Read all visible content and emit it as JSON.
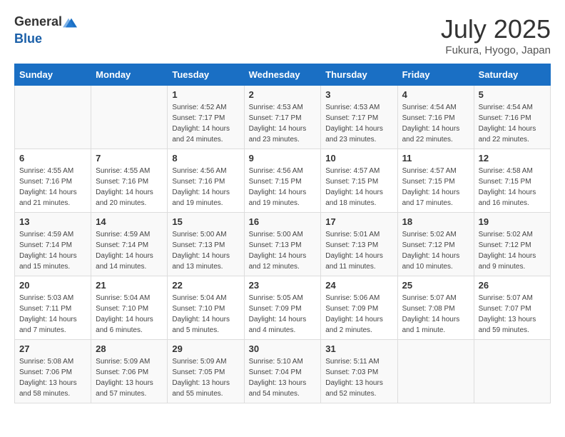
{
  "header": {
    "logo_general": "General",
    "logo_blue": "Blue",
    "month_year": "July 2025",
    "location": "Fukura, Hyogo, Japan"
  },
  "days_of_week": [
    "Sunday",
    "Monday",
    "Tuesday",
    "Wednesday",
    "Thursday",
    "Friday",
    "Saturday"
  ],
  "weeks": [
    [
      {
        "day": "",
        "empty": true
      },
      {
        "day": "",
        "empty": true
      },
      {
        "day": "1",
        "sunrise": "4:52 AM",
        "sunset": "7:17 PM",
        "daylight": "14 hours and 24 minutes."
      },
      {
        "day": "2",
        "sunrise": "4:53 AM",
        "sunset": "7:17 PM",
        "daylight": "14 hours and 23 minutes."
      },
      {
        "day": "3",
        "sunrise": "4:53 AM",
        "sunset": "7:17 PM",
        "daylight": "14 hours and 23 minutes."
      },
      {
        "day": "4",
        "sunrise": "4:54 AM",
        "sunset": "7:16 PM",
        "daylight": "14 hours and 22 minutes."
      },
      {
        "day": "5",
        "sunrise": "4:54 AM",
        "sunset": "7:16 PM",
        "daylight": "14 hours and 22 minutes."
      }
    ],
    [
      {
        "day": "6",
        "sunrise": "4:55 AM",
        "sunset": "7:16 PM",
        "daylight": "14 hours and 21 minutes."
      },
      {
        "day": "7",
        "sunrise": "4:55 AM",
        "sunset": "7:16 PM",
        "daylight": "14 hours and 20 minutes."
      },
      {
        "day": "8",
        "sunrise": "4:56 AM",
        "sunset": "7:16 PM",
        "daylight": "14 hours and 19 minutes."
      },
      {
        "day": "9",
        "sunrise": "4:56 AM",
        "sunset": "7:15 PM",
        "daylight": "14 hours and 19 minutes."
      },
      {
        "day": "10",
        "sunrise": "4:57 AM",
        "sunset": "7:15 PM",
        "daylight": "14 hours and 18 minutes."
      },
      {
        "day": "11",
        "sunrise": "4:57 AM",
        "sunset": "7:15 PM",
        "daylight": "14 hours and 17 minutes."
      },
      {
        "day": "12",
        "sunrise": "4:58 AM",
        "sunset": "7:15 PM",
        "daylight": "14 hours and 16 minutes."
      }
    ],
    [
      {
        "day": "13",
        "sunrise": "4:59 AM",
        "sunset": "7:14 PM",
        "daylight": "14 hours and 15 minutes."
      },
      {
        "day": "14",
        "sunrise": "4:59 AM",
        "sunset": "7:14 PM",
        "daylight": "14 hours and 14 minutes."
      },
      {
        "day": "15",
        "sunrise": "5:00 AM",
        "sunset": "7:13 PM",
        "daylight": "14 hours and 13 minutes."
      },
      {
        "day": "16",
        "sunrise": "5:00 AM",
        "sunset": "7:13 PM",
        "daylight": "14 hours and 12 minutes."
      },
      {
        "day": "17",
        "sunrise": "5:01 AM",
        "sunset": "7:13 PM",
        "daylight": "14 hours and 11 minutes."
      },
      {
        "day": "18",
        "sunrise": "5:02 AM",
        "sunset": "7:12 PM",
        "daylight": "14 hours and 10 minutes."
      },
      {
        "day": "19",
        "sunrise": "5:02 AM",
        "sunset": "7:12 PM",
        "daylight": "14 hours and 9 minutes."
      }
    ],
    [
      {
        "day": "20",
        "sunrise": "5:03 AM",
        "sunset": "7:11 PM",
        "daylight": "14 hours and 7 minutes."
      },
      {
        "day": "21",
        "sunrise": "5:04 AM",
        "sunset": "7:10 PM",
        "daylight": "14 hours and 6 minutes."
      },
      {
        "day": "22",
        "sunrise": "5:04 AM",
        "sunset": "7:10 PM",
        "daylight": "14 hours and 5 minutes."
      },
      {
        "day": "23",
        "sunrise": "5:05 AM",
        "sunset": "7:09 PM",
        "daylight": "14 hours and 4 minutes."
      },
      {
        "day": "24",
        "sunrise": "5:06 AM",
        "sunset": "7:09 PM",
        "daylight": "14 hours and 2 minutes."
      },
      {
        "day": "25",
        "sunrise": "5:07 AM",
        "sunset": "7:08 PM",
        "daylight": "14 hours and 1 minute."
      },
      {
        "day": "26",
        "sunrise": "5:07 AM",
        "sunset": "7:07 PM",
        "daylight": "13 hours and 59 minutes."
      }
    ],
    [
      {
        "day": "27",
        "sunrise": "5:08 AM",
        "sunset": "7:06 PM",
        "daylight": "13 hours and 58 minutes."
      },
      {
        "day": "28",
        "sunrise": "5:09 AM",
        "sunset": "7:06 PM",
        "daylight": "13 hours and 57 minutes."
      },
      {
        "day": "29",
        "sunrise": "5:09 AM",
        "sunset": "7:05 PM",
        "daylight": "13 hours and 55 minutes."
      },
      {
        "day": "30",
        "sunrise": "5:10 AM",
        "sunset": "7:04 PM",
        "daylight": "13 hours and 54 minutes."
      },
      {
        "day": "31",
        "sunrise": "5:11 AM",
        "sunset": "7:03 PM",
        "daylight": "13 hours and 52 minutes."
      },
      {
        "day": "",
        "empty": true
      },
      {
        "day": "",
        "empty": true
      }
    ]
  ]
}
